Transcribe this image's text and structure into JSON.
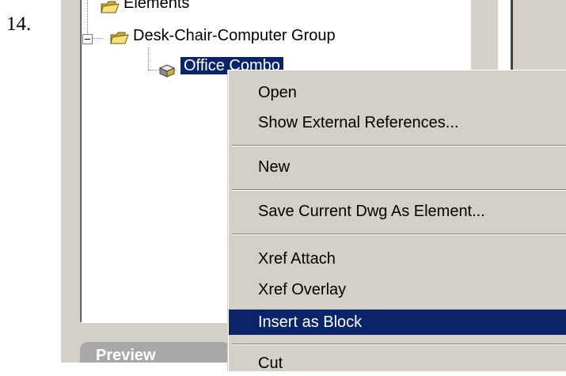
{
  "step_number": "14.",
  "tree": {
    "items": [
      {
        "label": "Elements",
        "icon": "folder-icon"
      },
      {
        "label": "Desk-Chair-Computer Group",
        "icon": "folder-icon",
        "expanded": true
      },
      {
        "label": "Office Combo",
        "icon": "block-icon",
        "selected": true
      }
    ]
  },
  "tabs": {
    "preview": "Preview"
  },
  "context_menu": {
    "items": [
      {
        "label": "Open"
      },
      {
        "label": "Show External References..."
      },
      {
        "label": "New"
      },
      {
        "label": "Save Current Dwg As Element..."
      },
      {
        "label": "Xref Attach"
      },
      {
        "label": "Xref Overlay"
      },
      {
        "label": "Insert as Block",
        "highlighted": true
      },
      {
        "label": "Cut"
      }
    ]
  },
  "colors": {
    "selection": "#0a246a",
    "panel": "#d4d0c8"
  }
}
